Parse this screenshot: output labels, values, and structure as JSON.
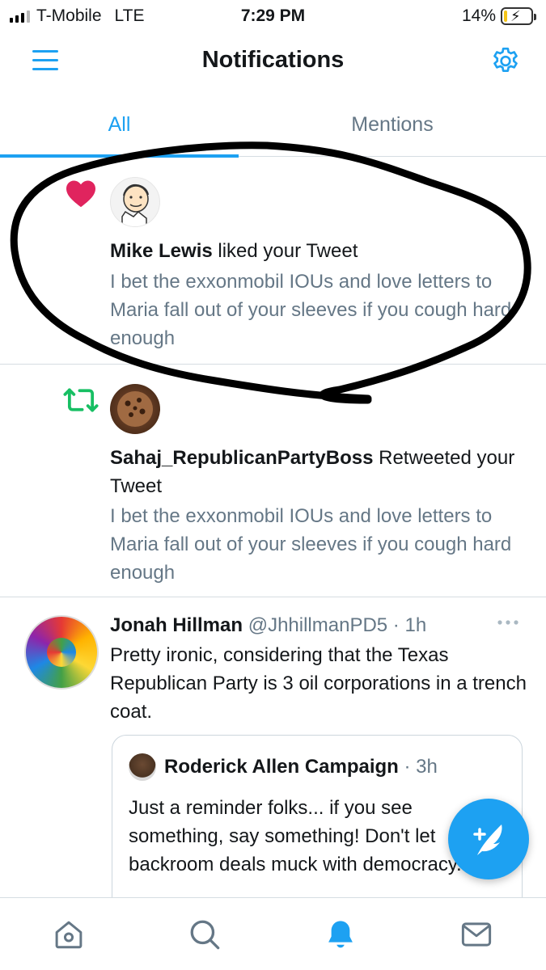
{
  "status_bar": {
    "carrier": "T-Mobile",
    "network": "LTE",
    "time": "7:29 PM",
    "battery_percent": "14%",
    "battery_level": 0.14,
    "battery_color": "#f5c518"
  },
  "header": {
    "title": "Notifications",
    "menu_icon": "hamburger-menu-icon",
    "settings_icon": "gear-icon"
  },
  "tabs": [
    {
      "label": "All",
      "selected": true
    },
    {
      "label": "Mentions",
      "selected": false
    }
  ],
  "notifications": [
    {
      "type": "like",
      "icon": "heart-icon",
      "icon_color": "#e0245e",
      "user": "Mike Lewis",
      "action": " liked your Tweet",
      "tweet_text": "I bet the exxonmobil IOUs and love letters to Maria fall out of your sleeves if you cough hard enough"
    },
    {
      "type": "retweet",
      "icon": "retweet-icon",
      "icon_color": "#17bf63",
      "user": "Sahaj_RepublicanPartyBoss",
      "action": " Retweeted your Tweet",
      "tweet_text": "I bet the exxonmobil IOUs and love letters to Maria fall out of your sleeves if you cough hard enough"
    }
  ],
  "tweet": {
    "name": "Jonah Hillman",
    "handle": " @JhhillmanPD5",
    "time": " · 1h",
    "text": "Pretty ironic, considering that the Texas Republican Party is 3 oil corporations in a trench coat.",
    "quote": {
      "name": "Roderick Allen Campaign",
      "time": " · 3h",
      "text": "Just a reminder folks... if you see something, say something! Don't let backroom deals muck with democracy..."
    }
  },
  "compose_button_icon": "compose-feather-icon",
  "tab_bar": [
    {
      "icon": "home-icon",
      "selected": false
    },
    {
      "icon": "search-icon",
      "selected": false
    },
    {
      "icon": "bell-icon",
      "selected": true
    },
    {
      "icon": "mail-icon",
      "selected": false
    }
  ],
  "colors": {
    "accent": "#1da1f2",
    "text_primary": "#14171a",
    "text_secondary": "#657786",
    "divider": "#d6dde2",
    "annotation_ink": "#000000"
  }
}
